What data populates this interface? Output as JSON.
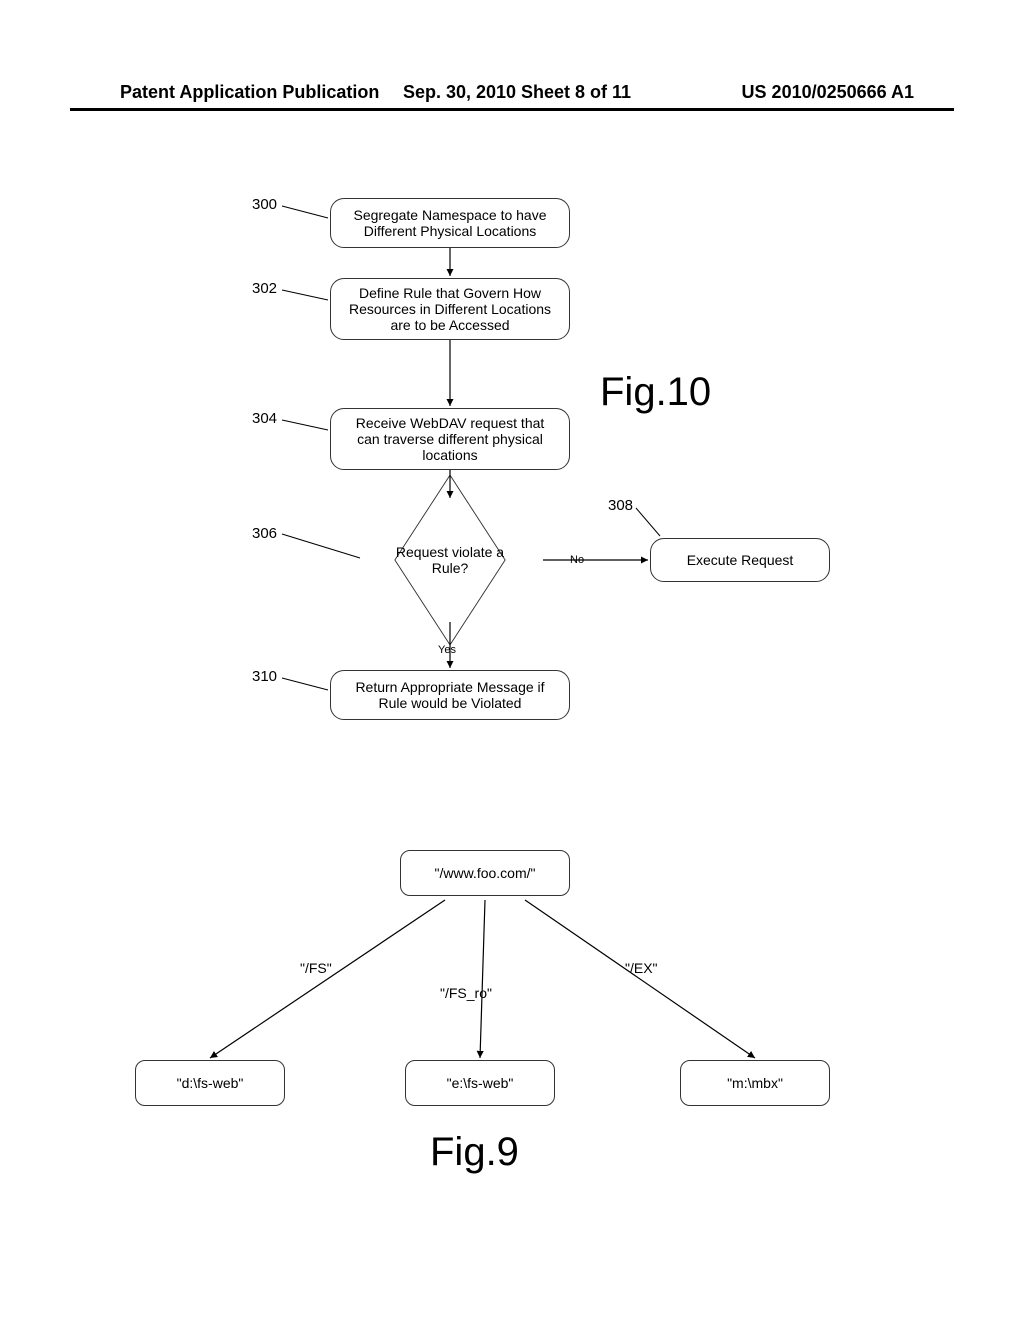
{
  "header": {
    "left": "Patent Application Publication",
    "center": "Sep. 30, 2010  Sheet 8 of 11",
    "right": "US 2010/0250666 A1"
  },
  "fig10": {
    "title": "Fig.10",
    "steps": {
      "s300": {
        "ref": "300",
        "text": "Segregate Namespace to have Different Physical Locations"
      },
      "s302": {
        "ref": "302",
        "text": "Define Rule that Govern How Resources in Different Locations are to be Accessed"
      },
      "s304": {
        "ref": "304",
        "text": "Receive WebDAV request that can traverse different physical locations"
      },
      "s306": {
        "ref": "306",
        "text": "Request violate a Rule?"
      },
      "s308": {
        "ref": "308",
        "text": "Execute Request"
      },
      "s310": {
        "ref": "310",
        "text": "Return Appropriate Message if Rule would be Violated"
      }
    },
    "branches": {
      "no": "No",
      "yes": "Yes"
    }
  },
  "fig9": {
    "title": "Fig.9",
    "root": "\"/www.foo.com/\"",
    "edges": {
      "left": "\"/FS\"",
      "mid": "\"/FS_ro\"",
      "right": "\"/EX\""
    },
    "leaves": {
      "left": "\"d:\\fs-web\"",
      "mid": "\"e:\\fs-web\"",
      "right": "\"m:\\mbx\""
    }
  }
}
